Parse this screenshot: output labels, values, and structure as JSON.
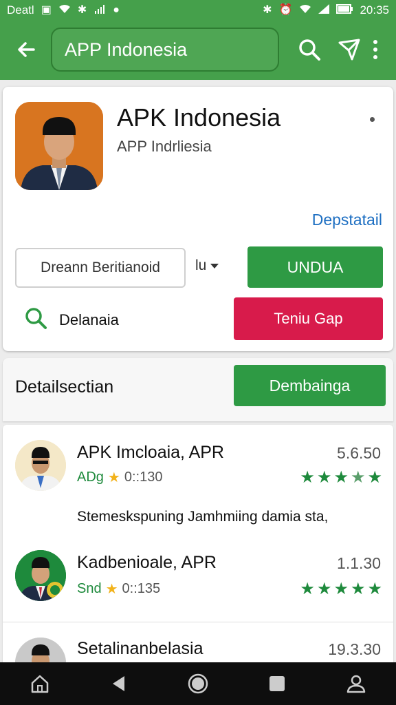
{
  "status_bar": {
    "carrier": "Deatl",
    "time": "20:35"
  },
  "app_bar": {
    "search_text": "APP Indonesia",
    "icons": [
      "back-arrow-icon",
      "search-icon",
      "share-icon",
      "more-vert-icon"
    ]
  },
  "app_card": {
    "name": "APK Indonesia",
    "subtitle": "APP Indrliesia",
    "detail_link": "Depstatail",
    "input_value": "Dreann Beritianoid",
    "lang_select": "lu",
    "download_button": "UNDUA",
    "search_label": "Delanaia",
    "red_button": "Teniu Gap"
  },
  "section": {
    "title": "Detailsectian",
    "button": "Dembainga"
  },
  "list": [
    {
      "title": "APK Imcloaia, APR",
      "version": "5.6.50",
      "tag": "ADg",
      "meta": "0::130",
      "rating": 4,
      "description": "Stemeskspuning Jamhmiing damia sta,"
    },
    {
      "title": "Kadbenioale, APR",
      "version": "1.1.30",
      "tag": "Snd",
      "meta": "0::135",
      "rating": 5
    },
    {
      "title": "Setalinanbelasia",
      "version": "19.3.30"
    }
  ],
  "colors": {
    "primary_green": "#45a04b",
    "button_green": "#2e9a44",
    "accent_red": "#d81b4b",
    "link_blue": "#1e6fc2"
  }
}
